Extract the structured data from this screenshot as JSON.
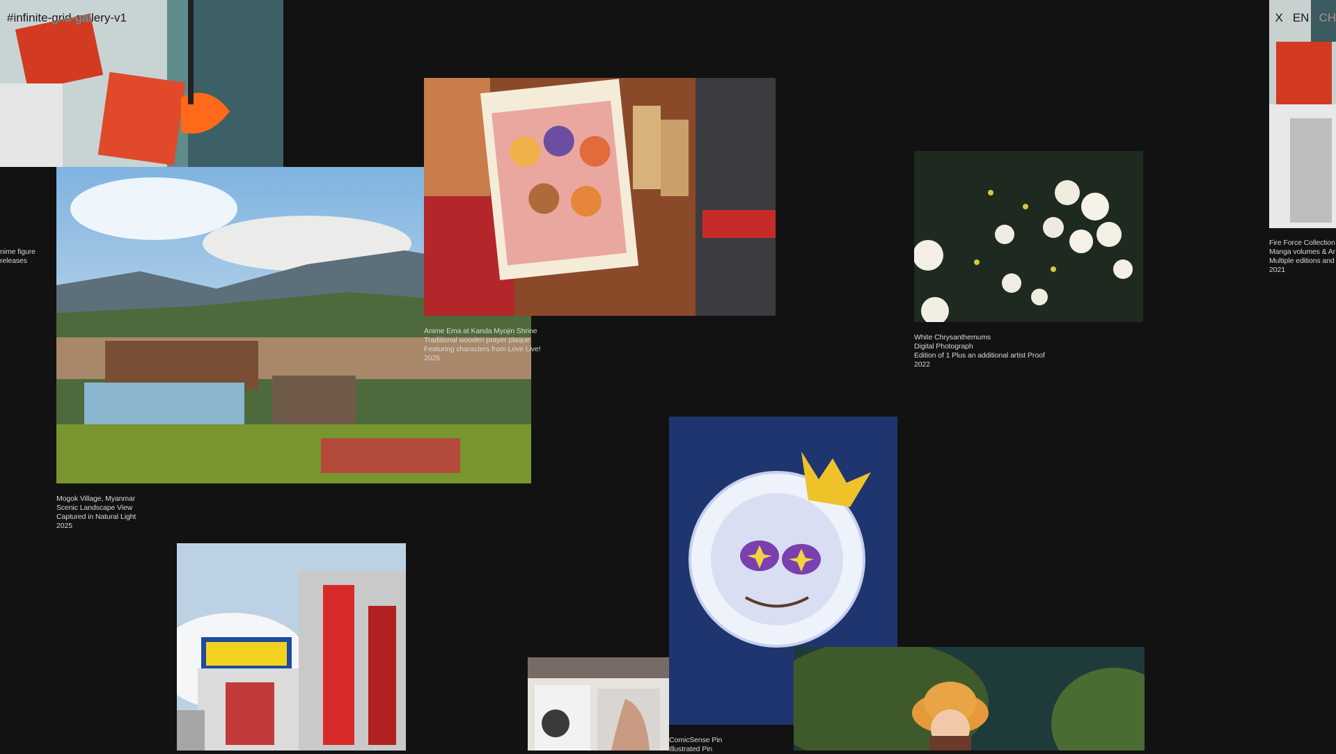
{
  "header": {
    "site_title": "#infinite-grid-gallery-v1",
    "lang": [
      "X",
      "EN",
      "CH"
    ]
  },
  "gallery": [
    {
      "caption": [
        "",
        "nime figure",
        "releases"
      ]
    },
    {
      "caption": [
        "Mogok Village, Myanmar",
        "Scenic Landscape View",
        "Captured in Natural Light",
        "2025"
      ]
    },
    {
      "caption": [
        "Anime Ema at Kanda Myojin Shrine",
        "Traditional wooden prayer plaque",
        "Featuring characters from Love Live!",
        "2025"
      ]
    },
    {
      "caption": [
        "White Chrysanthemums",
        "Digital Photograph",
        "Edition of 1 Plus an additional artist Proof",
        "2022"
      ]
    },
    {
      "caption": [
        "Fire Force Collection",
        "Manga volumes & Ar",
        "Multiple editions and",
        "2021"
      ]
    },
    {
      "caption": [
        "ComicSense Pin",
        "Illustrated Pin"
      ]
    }
  ],
  "colors": {
    "background": "#121212",
    "text": "#e6e6e6"
  }
}
